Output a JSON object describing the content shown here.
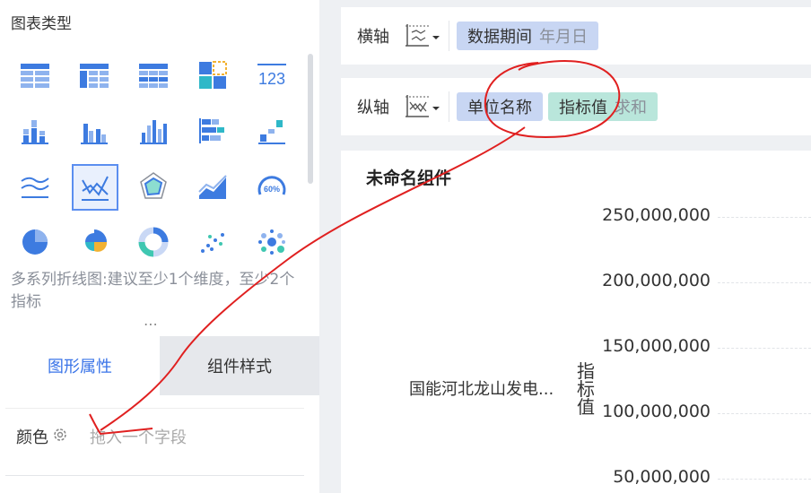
{
  "left_panel": {
    "title": "图表类型",
    "chart_types": [
      {
        "icon": "table-icon"
      },
      {
        "icon": "cross-table-icon"
      },
      {
        "icon": "detail-table-icon"
      },
      {
        "icon": "kpi-card-icon"
      },
      {
        "icon": "number-icon",
        "text": "123"
      },
      {
        "icon": "stacked-column-icon"
      },
      {
        "icon": "grouped-column-icon"
      },
      {
        "icon": "column-icon"
      },
      {
        "icon": "stacked-bar-icon"
      },
      {
        "icon": "step-bar-icon"
      },
      {
        "icon": "multi-line-icon"
      },
      {
        "icon": "multi-series-line-icon",
        "selected": true
      },
      {
        "icon": "radar-icon"
      },
      {
        "icon": "area-icon"
      },
      {
        "icon": "gauge-icon",
        "text": "60%"
      },
      {
        "icon": "pie-icon"
      },
      {
        "icon": "rose-pie-icon"
      },
      {
        "icon": "donut-icon"
      },
      {
        "icon": "scatter-icon"
      },
      {
        "icon": "bubble-icon"
      }
    ],
    "hint": "多系列折线图:建议至少1个维度，至少2个指标",
    "tabs": [
      {
        "label": "图形属性",
        "active": true
      },
      {
        "label": "组件样式",
        "active": false
      }
    ],
    "color_field": {
      "label": "颜色",
      "placeholder": "拖入一个字段"
    }
  },
  "x_axis": {
    "label": "横轴",
    "fields": [
      {
        "name": "数据期间",
        "sub": "年月日",
        "color": "#c8d6f3"
      }
    ]
  },
  "y_axis": {
    "label": "纵轴",
    "fields": [
      {
        "name": "单位名称",
        "sub": "",
        "color": "#c8d6f3"
      },
      {
        "name": "指标值",
        "sub": "求和",
        "color": "#b9e6db"
      }
    ]
  },
  "chart": {
    "title": "未命名组件"
  },
  "chart_data": {
    "type": "line",
    "title": "未命名组件",
    "ylabel": "指标值",
    "categories": [
      "国能河北龙山发电..."
    ],
    "y_ticks": [
      "250,000,000",
      "200,000,000",
      "150,000,000",
      "100,000,000",
      "50,000,000"
    ],
    "ylim": [
      50000000,
      250000000
    ],
    "grid": true
  },
  "colors": {
    "accent": "#3a74e8",
    "annotation": "#e02020",
    "pill_dimension": "#c8d6f3",
    "pill_measure": "#b9e6db"
  }
}
